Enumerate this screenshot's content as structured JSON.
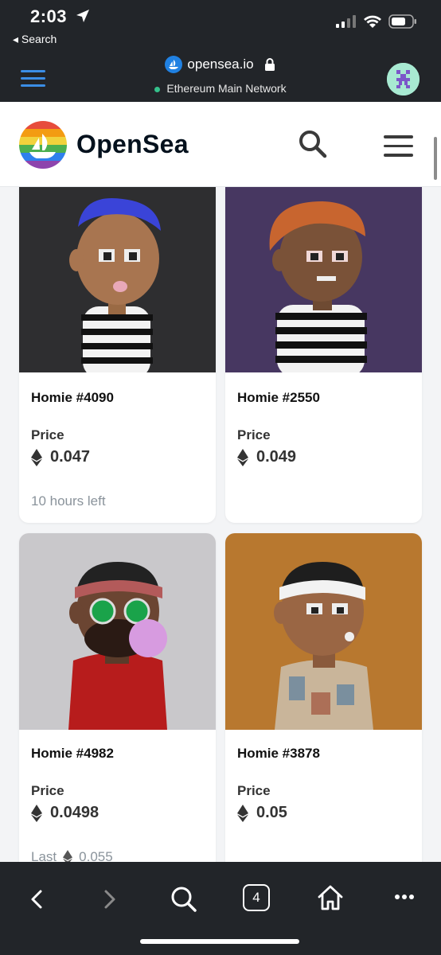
{
  "status": {
    "time": "2:03"
  },
  "browser_header": {
    "back_label": "◂ Search",
    "url": "opensea.io",
    "network": "Ethereum Main Network"
  },
  "opensea": {
    "brand": "OpenSea"
  },
  "cards": [
    {
      "name": "Homie #4090",
      "price_label": "Price",
      "price": "0.047",
      "meta": "10 hours left",
      "bg": "#2e2e30"
    },
    {
      "name": "Homie #2550",
      "price_label": "Price",
      "price": "0.049",
      "meta": "",
      "bg": "#473761"
    },
    {
      "name": "Homie #4982",
      "price_label": "Price",
      "price": "0.0498",
      "meta_prefix": "Last",
      "meta_value": "0.055",
      "bg": "#c9c8cb"
    },
    {
      "name": "Homie #3878",
      "price_label": "Price",
      "price": "0.05",
      "meta": "",
      "bg": "#b8782f"
    }
  ],
  "bottom_bar": {
    "tabs_count": "4"
  },
  "colors": {
    "accent_blue": "#3b8ee6",
    "network_dot": "#35c18b",
    "dark_bar": "#222529"
  }
}
